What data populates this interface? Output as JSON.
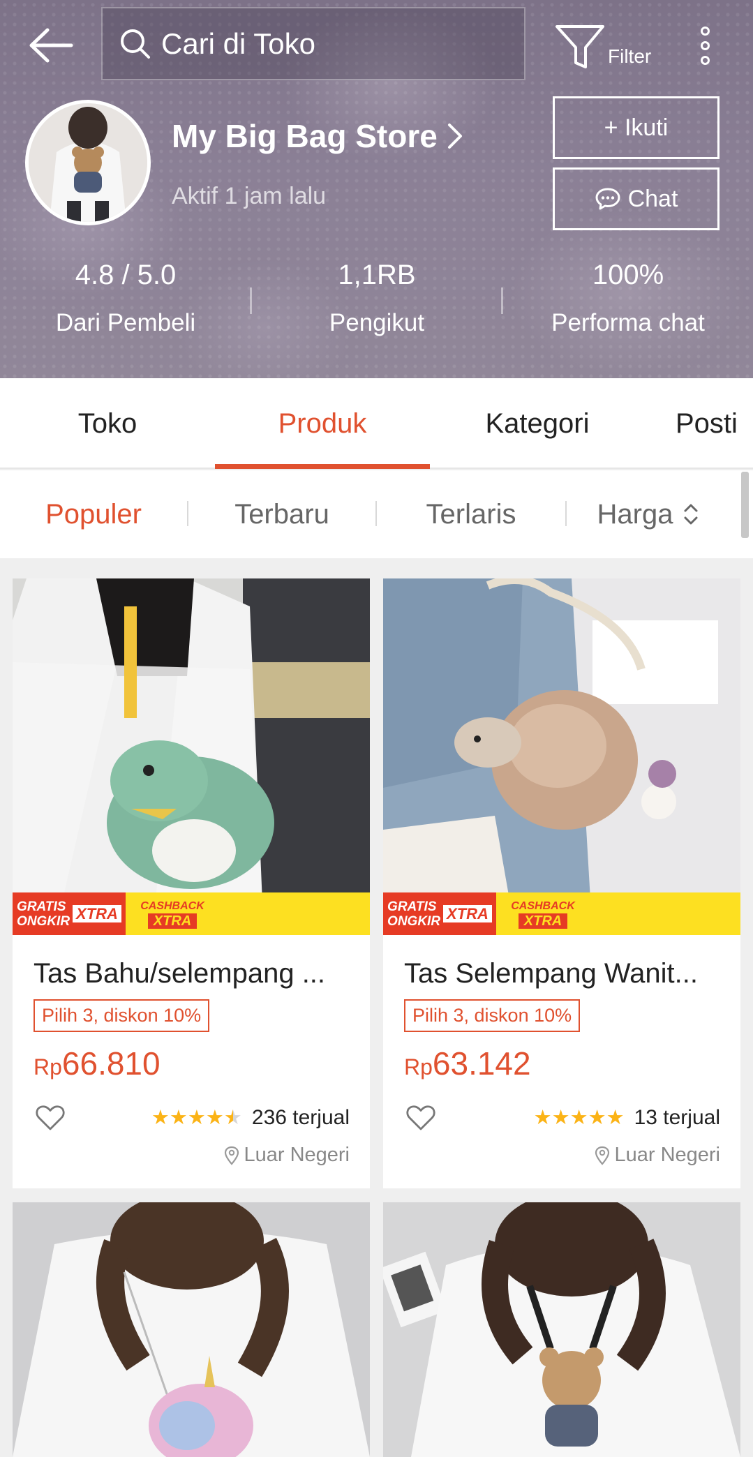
{
  "header": {
    "search_placeholder": "Cari di Toko",
    "filter_label": "Filter",
    "store_name": "My Big Bag Store",
    "store_status": "Aktif 1 jam lalu",
    "follow_label": "+ Ikuti",
    "chat_label": "Chat",
    "stats": [
      {
        "value": "4.8 / 5.0",
        "label": "Dari Pembeli"
      },
      {
        "value": "1,1RB",
        "label": "Pengikut"
      },
      {
        "value": "100%",
        "label": "Performa chat"
      }
    ]
  },
  "tabs": [
    "Toko",
    "Produk",
    "Kategori",
    "Posti"
  ],
  "active_tab": "Produk",
  "sort": [
    "Populer",
    "Terbaru",
    "Terlaris",
    "Harga"
  ],
  "active_sort": "Populer",
  "promo": {
    "gratis_line1": "GRATIS",
    "gratis_line2": "ONGKIR",
    "xtra": "XTRA",
    "cashback": "CASHBACK",
    "cashback_xtra": "XTRA"
  },
  "products": [
    {
      "title": "Tas Bahu/selempang ...",
      "badge": "Pilih 3, diskon 10%",
      "currency": "Rp",
      "price": "66.810",
      "rating": 4.5,
      "sold": "236 terjual",
      "location": "Luar Negeri"
    },
    {
      "title": "Tas Selempang Wanit...",
      "badge": "Pilih 3, diskon 10%",
      "currency": "Rp",
      "price": "63.142",
      "rating": 5,
      "sold": "13 terjual",
      "location": "Luar Negeri"
    }
  ],
  "colors": {
    "accent": "#e0512f",
    "star": "#fbb316",
    "promo_red": "#e63b24",
    "promo_yellow": "#fde021"
  }
}
